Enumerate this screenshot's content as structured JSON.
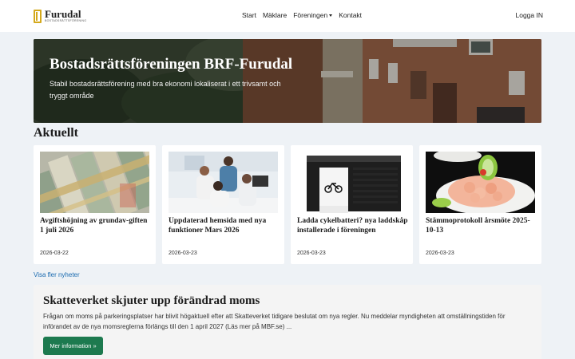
{
  "brand": {
    "name": "Furudal",
    "tagline": "BOSTADSRÄTTSFÖRENING",
    "accent": "#d4a91c"
  },
  "nav": {
    "items": [
      {
        "label": "Start"
      },
      {
        "label": "Mäklare"
      },
      {
        "label": "Föreningen",
        "dropdown": true
      },
      {
        "label": "Kontakt"
      }
    ],
    "login": "Logga IN"
  },
  "hero": {
    "title": "Bostadsrättsföreningen BRF-Furudal",
    "text": "Stabil bostadsrättsförening med bra ekonomi lokaliserat i ett trivsamt och tryggt område"
  },
  "news": {
    "heading": "Aktuellt",
    "items": [
      {
        "title": "Avgiftshöjning av grundav-giften 1 juli 2026",
        "date": "2026-03-22",
        "image": "money-bills"
      },
      {
        "title": "Uppdaterad hemsida med nya funktioner Mars 2026",
        "date": "2026-03-23",
        "image": "team-at-computer"
      },
      {
        "title": "Ladda cykelbatteri? nya laddskåp installerade i föreningen",
        "date": "2026-03-23",
        "image": "bike-charging-lockers"
      },
      {
        "title": "Stämmoprotokoll årsmöte 2025-10-13",
        "date": "2026-03-23",
        "image": "shrimp-sandwich"
      }
    ],
    "more": "Visa fler nyheter"
  },
  "announcement": {
    "title": "Skatteverket skjuter upp förändrad moms",
    "text": "Frågan om moms på parkeringsplatser har blivit högaktuell efter att Skatteverket tidigare beslutat om nya regler. Nu meddelar myndigheten att omställningstiden för införandet av de nya momsreglerna förlängs till den 1 april 2027 (Läs mer på MBF.se) ...",
    "button": "Mer information »",
    "button_color": "#1d7a4f"
  }
}
